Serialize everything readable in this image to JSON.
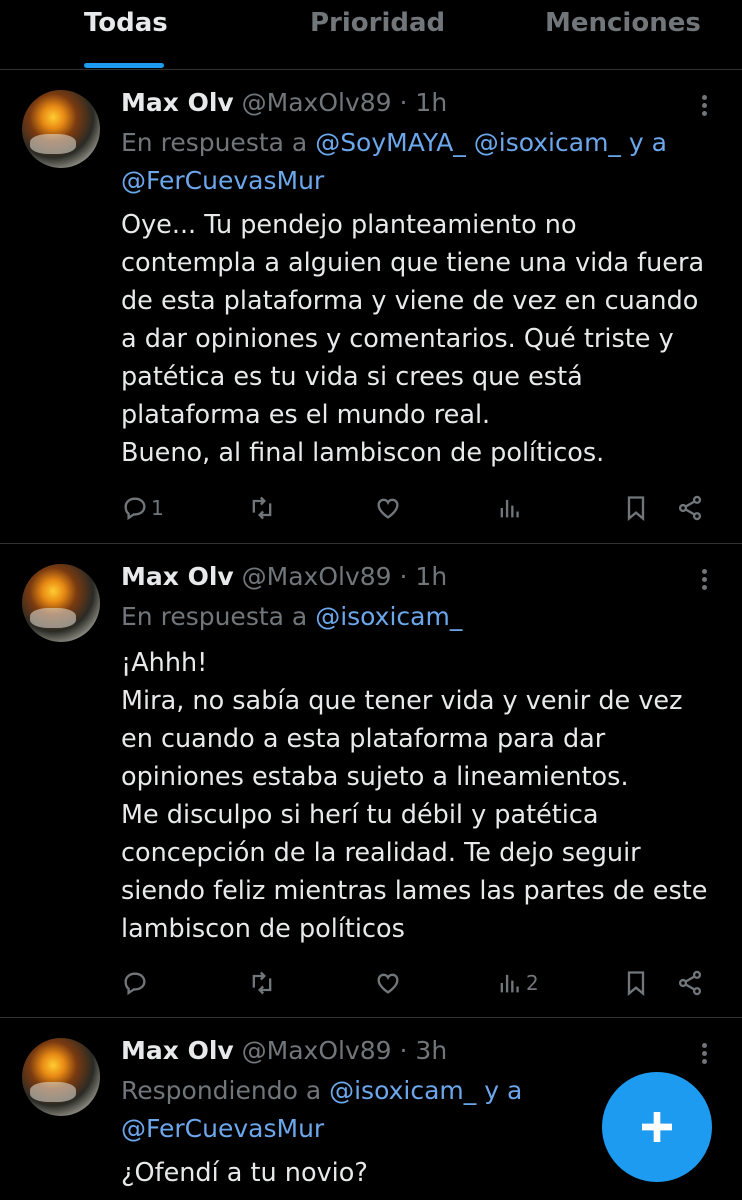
{
  "tabs": [
    {
      "label": "Todas",
      "active": true
    },
    {
      "label": "Prioridad",
      "active": false
    },
    {
      "label": "Menciones",
      "active": false
    }
  ],
  "tweets": [
    {
      "name": "Max Olv",
      "handle": "@MaxOlv89",
      "time": "· 1h",
      "reply_prefix": "En respuesta a ",
      "reply_users": [
        "@SoyMAYA_",
        "@isoxicam_"
      ],
      "reply_join": " y a",
      "reply_users_line2": [
        "@FerCuevasMur"
      ],
      "text": "Oye... Tu pendejo planteamiento no\ncontempla a alguien que tiene una vida fuera\nde esta plataforma y viene de vez en cuando\na dar opiniones y comentarios. Qué triste y\npatética es tu vida si crees que está\nplataforma es el mundo real.\nBueno, al final lambiscon de políticos.",
      "replies": "1",
      "views": ""
    },
    {
      "name": "Max Olv",
      "handle": "@MaxOlv89",
      "time": "· 1h",
      "reply_prefix": "En respuesta a ",
      "reply_users": [
        "@isoxicam_"
      ],
      "text": "¡Ahhh!\nMira, no sabía que tener vida y venir de vez\nen cuando a esta plataforma para dar\nopiniones estaba sujeto a lineamientos.\nMe disculpo si herí tu débil y patética\nconcepción de la realidad. Te dejo seguir\nsiendo feliz mientras lames las partes de este\nlambiscon de políticos",
      "replies": "",
      "views": "2"
    },
    {
      "name": "Max Olv",
      "handle": "@MaxOlv89",
      "time": "· 3h",
      "reply_prefix": "Respondiendo a ",
      "reply_users": [
        "@isoxicam_"
      ],
      "reply_join": " y a",
      "reply_users_line2": [
        "@FerCuevasMur"
      ],
      "text": "¿Ofendí a tu novio?"
    }
  ],
  "fab": {
    "icon": "plus-icon"
  },
  "colors": {
    "accent": "#1d9bf0",
    "link": "#6ca7ec",
    "muted": "#71767b",
    "text": "#e7e9ea",
    "divider": "#2f3336"
  }
}
